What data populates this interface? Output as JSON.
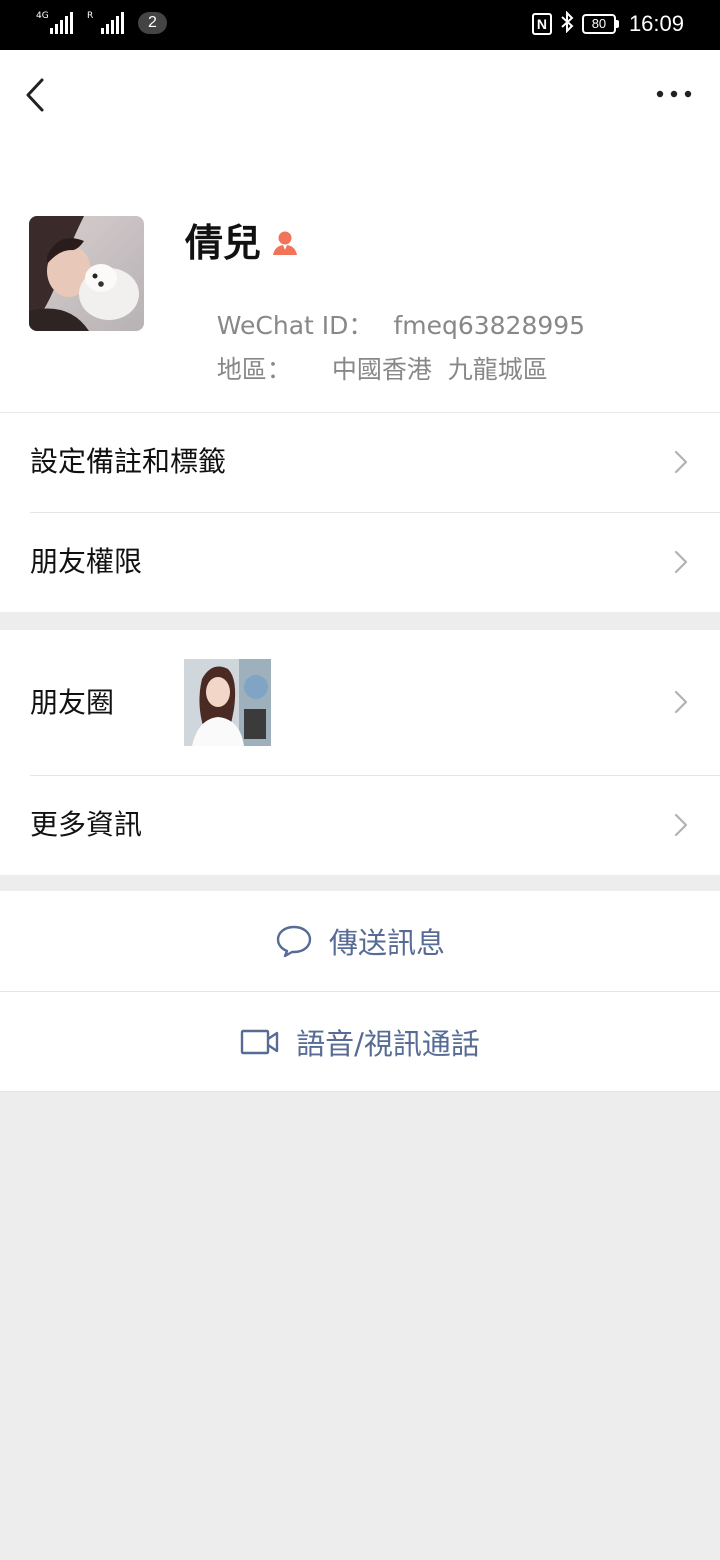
{
  "status_bar": {
    "sim1_label": "4G",
    "sim2_label": "R",
    "sim_badge": "2",
    "nfc_label": "N",
    "battery": "80",
    "time": "16:09"
  },
  "profile": {
    "name": "倩兒",
    "wechat_id_label": "WeChat ID：",
    "wechat_id_value": "fmeq63828995",
    "region_label": "地區：",
    "region_value": "中國香港  九龍城區",
    "badge_color": "#f0735a"
  },
  "menu1": {
    "items": [
      {
        "label": "設定備註和標籤"
      },
      {
        "label": "朋友權限"
      }
    ]
  },
  "menu2": {
    "moments_label": "朋友圈",
    "more_info_label": "更多資訊"
  },
  "actions": {
    "send_message": "傳送訊息",
    "voice_video_call": "語音/視訊通話",
    "accent_color": "#576b95"
  }
}
